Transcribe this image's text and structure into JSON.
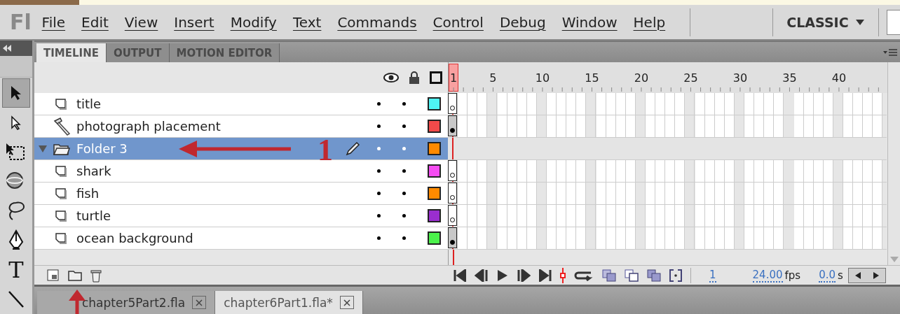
{
  "app": {
    "logo": "Fl"
  },
  "menu": [
    "File",
    "Edit",
    "View",
    "Insert",
    "Modify",
    "Text",
    "Commands",
    "Control",
    "Debug",
    "Window",
    "Help"
  ],
  "workspace": {
    "label": "CLASSIC"
  },
  "tools": [
    {
      "kind": "selection"
    },
    {
      "kind": "subselection"
    },
    {
      "kind": "transform"
    },
    {
      "kind": "rotate3d"
    },
    {
      "kind": "lasso"
    },
    {
      "kind": "pen"
    },
    {
      "kind": "text",
      "glyph": "T"
    },
    {
      "kind": "line"
    }
  ],
  "panel_tabs": [
    {
      "label": "TIMELINE",
      "selected": true
    },
    {
      "label": "OUTPUT",
      "selected": false
    },
    {
      "label": "MOTION EDITOR",
      "selected": false
    }
  ],
  "ruler": [
    "1",
    "5",
    "10",
    "15",
    "20",
    "25",
    "30",
    "35",
    "40"
  ],
  "layers": [
    {
      "name": "title",
      "kind": "layer",
      "selected": false,
      "color": "#4ef4f4",
      "keyframe": true,
      "filled": false
    },
    {
      "name": "photograph placement",
      "kind": "guide",
      "selected": false,
      "color": "#f24a4a",
      "keyframe": true,
      "filled": true
    },
    {
      "name": "Folder 3",
      "kind": "folder",
      "selected": true,
      "expanded": true,
      "color": "#ff8a00",
      "keyframe": false,
      "annotation": "1"
    },
    {
      "name": "shark",
      "kind": "layer",
      "selected": false,
      "color": "#f54cf2",
      "keyframe": true,
      "filled": false
    },
    {
      "name": "fish",
      "kind": "layer",
      "selected": false,
      "color": "#ff8a00",
      "keyframe": true,
      "filled": false
    },
    {
      "name": "turtle",
      "kind": "layer",
      "selected": false,
      "color": "#9a2ecf",
      "keyframe": true,
      "filled": false
    },
    {
      "name": "ocean background",
      "kind": "layer",
      "selected": false,
      "color": "#4cf24c",
      "keyframe": true,
      "filled": true
    }
  ],
  "status": {
    "frame": "1",
    "rate": "24.00",
    "rate_unit": "fps",
    "time": "0.0",
    "time_unit": "s"
  },
  "documents": [
    {
      "label": "chapter5Part2.fla",
      "selected": false
    },
    {
      "label": "chapter6Part1.fla*",
      "selected": true
    }
  ]
}
